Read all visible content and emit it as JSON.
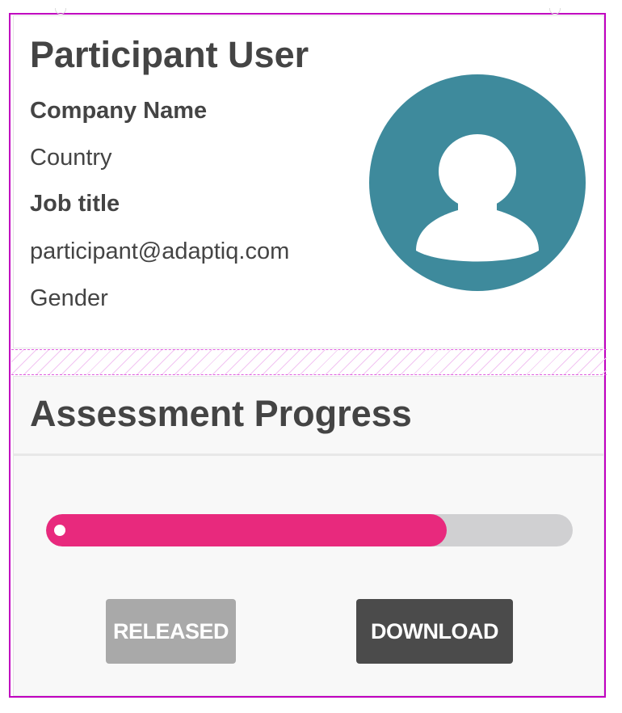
{
  "profile": {
    "name": "Participant User",
    "company": "Company Name",
    "country": "Country",
    "job_title": "Job title",
    "email": "participant@adaptiq.com",
    "gender": "Gender",
    "avatar_icon": "user-avatar-icon",
    "avatar_color": "#3e8a9c"
  },
  "assessment": {
    "title": "Assessment Progress",
    "progress": 0.76,
    "progress_color": "#e8297d",
    "released_label": "RELEASED",
    "download_label": "DOWNLOAD"
  }
}
